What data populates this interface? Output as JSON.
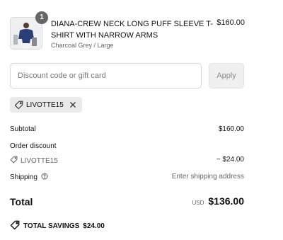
{
  "cart_item": {
    "quantity": "1",
    "title": "DIANA-CREW NECK LONG PUFF SLEEVE T-SHIRT WITH NARROW ARMS",
    "variant": "Charcoal Grey / Large",
    "price": "$160.00"
  },
  "discount": {
    "placeholder": "Discount code or gift card",
    "value": "",
    "apply_label": "Apply",
    "applied_code": "LIVOTTE15"
  },
  "summary": {
    "subtotal_label": "Subtotal",
    "subtotal_value": "$160.00",
    "order_discount_label": "Order discount",
    "discount_code": "LIVOTTE15",
    "discount_value": "− $24.00",
    "shipping_label": "Shipping",
    "shipping_value": "Enter shipping address",
    "total_label": "Total",
    "currency": "USD",
    "total_value": "$136.00",
    "savings_label": "TOTAL SAVINGS",
    "savings_value": "$24.00"
  },
  "icons": {
    "tag": "tag-icon",
    "close": "close-icon",
    "help": "help-circle-icon"
  }
}
